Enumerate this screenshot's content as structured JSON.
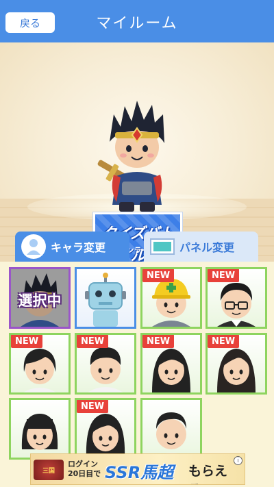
{
  "header": {
    "back_label": "戻る",
    "title": "マイルーム"
  },
  "stage": {
    "panel_logo_main": "クイズバトル",
    "panel_logo_sub": "オンライン"
  },
  "tabs": [
    {
      "label": "キャラ変更",
      "icon": "person-icon",
      "active": true
    },
    {
      "label": "パネル変更",
      "icon": "panel-icon",
      "active": false
    }
  ],
  "characters": [
    {
      "kind": "hero",
      "badge": "",
      "overlay": "選択中",
      "selected": true
    },
    {
      "kind": "robot",
      "badge": ""
    },
    {
      "kind": "worker",
      "badge": "NEW"
    },
    {
      "kind": "glasses-man",
      "badge": "NEW"
    },
    {
      "kind": "girl-short",
      "badge": "NEW"
    },
    {
      "kind": "boy",
      "badge": "NEW"
    },
    {
      "kind": "woman-long",
      "badge": "NEW"
    },
    {
      "kind": "woman-long-2",
      "badge": "NEW"
    },
    {
      "kind": "girl-bob",
      "badge": ""
    },
    {
      "kind": "woman-bob",
      "badge": "NEW"
    },
    {
      "kind": "man-short",
      "badge": ""
    }
  ],
  "ad": {
    "small_line1": "ログイン",
    "small_line2": "20日目で",
    "big": "SSR馬超",
    "tail": "もらえる!",
    "info": "i",
    "logo_text": "三国"
  },
  "colors": {
    "header": "#4a8ee6",
    "badge": "#e8413a",
    "card_border": "#8ed45f",
    "selected_border": "#9a55c9"
  }
}
